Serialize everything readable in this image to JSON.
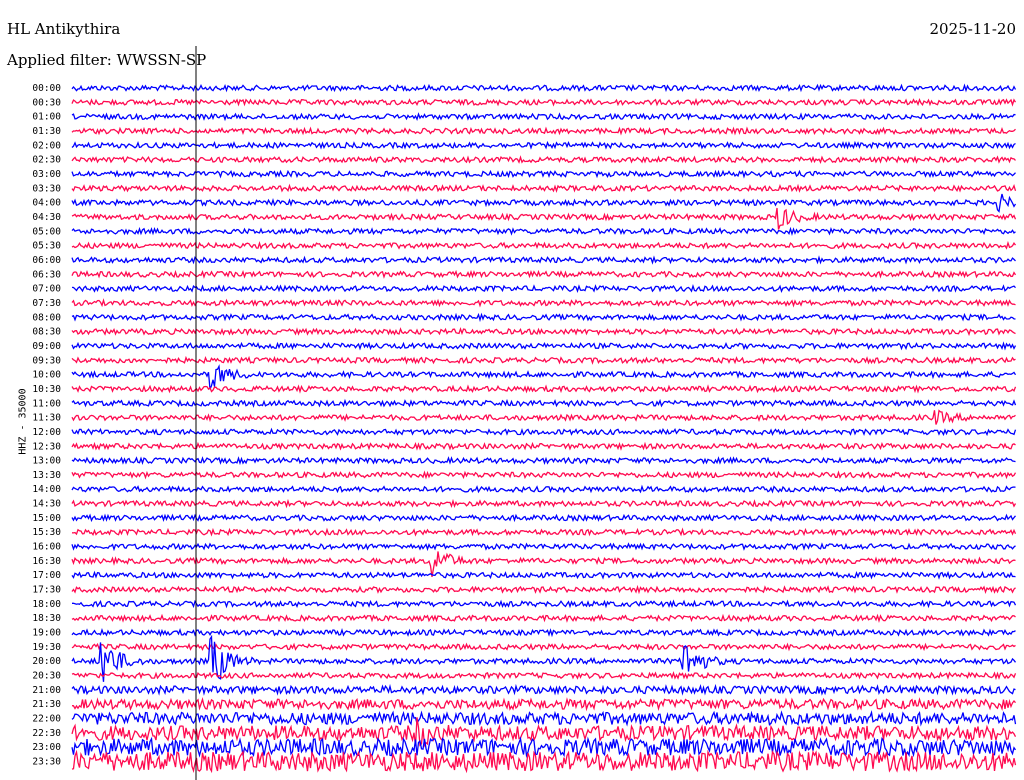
{
  "header": {
    "station": "HL Antikythira",
    "date": "2025-11-20",
    "filter": "Applied filter: WWSSN-SP",
    "channel": "HHZ - 35000"
  },
  "colors": {
    "trace_a": "#0000ff",
    "trace_b": "#ff0a50",
    "marker": "#000000"
  },
  "chart_data": {
    "type": "line",
    "title": "HL Antikythira",
    "subtitle": "Applied filter: WWSSN-SP",
    "ylabel": "HHZ - 35000",
    "xlabel": "",
    "grid": false,
    "legend": "none",
    "categories": [
      "00:00",
      "00:30",
      "01:00",
      "01:30",
      "02:00",
      "02:30",
      "03:00",
      "03:30",
      "04:00",
      "04:30",
      "05:00",
      "05:30",
      "06:00",
      "06:30",
      "07:00",
      "07:30",
      "08:00",
      "08:30",
      "09:00",
      "09:30",
      "10:00",
      "10:30",
      "11:00",
      "11:30",
      "12:00",
      "12:30",
      "13:00",
      "13:30",
      "14:00",
      "14:30",
      "15:00",
      "15:30",
      "16:00",
      "16:30",
      "17:00",
      "17:30",
      "18:00",
      "18:30",
      "19:00",
      "19:30",
      "20:00",
      "20:30",
      "21:00",
      "21:30",
      "22:00",
      "22:30",
      "23:00",
      "23:30"
    ],
    "xlim": [
      0,
      30
    ],
    "events": [
      {
        "row": "04:00",
        "minute": 29.5,
        "amp": 0.8
      },
      {
        "row": "04:30",
        "minute": 22.5,
        "amp": 1.2
      },
      {
        "row": "10:00",
        "minute": 4.5,
        "amp": 1.6
      },
      {
        "row": "11:30",
        "minute": 27.5,
        "amp": 0.6
      },
      {
        "row": "16:30",
        "minute": 11.5,
        "amp": 1.8
      },
      {
        "row": "20:00",
        "minute": 1.0,
        "amp": 3.0
      },
      {
        "row": "20:00",
        "minute": 4.5,
        "amp": 3.0
      },
      {
        "row": "20:00",
        "minute": 19.5,
        "amp": 2.5
      },
      {
        "row": "22:30",
        "minute": 11.0,
        "amp": 1.2
      }
    ]
  }
}
